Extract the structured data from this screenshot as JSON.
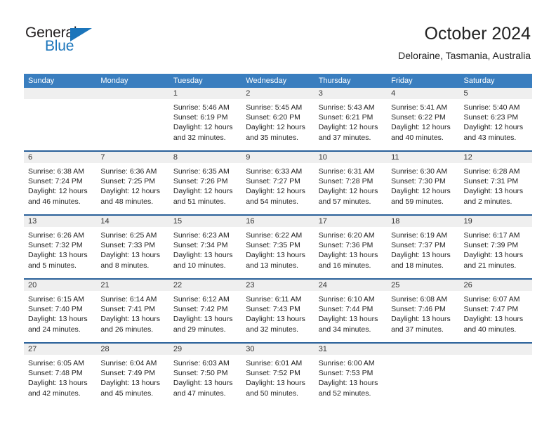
{
  "brand": {
    "name_top": "General",
    "name_bottom": "Blue",
    "accent_color": "#1b75bb",
    "text_color": "#231f20"
  },
  "header": {
    "title": "October 2024",
    "subtitle": "Deloraine, Tasmania, Australia"
  },
  "theme": {
    "header_row_bg": "#3a7ebf",
    "week_divider": "#2a6099",
    "day_number_bg": "#efefef",
    "page_bg": "#ffffff"
  },
  "weekdays": [
    "Sunday",
    "Monday",
    "Tuesday",
    "Wednesday",
    "Thursday",
    "Friday",
    "Saturday"
  ],
  "weeks": [
    [
      {
        "day": "",
        "empty": true,
        "lines": []
      },
      {
        "day": "",
        "empty": true,
        "lines": []
      },
      {
        "day": "1",
        "empty": false,
        "lines": [
          "Sunrise: 5:46 AM",
          "Sunset: 6:19 PM",
          "Daylight: 12 hours",
          "and 32 minutes."
        ]
      },
      {
        "day": "2",
        "empty": false,
        "lines": [
          "Sunrise: 5:45 AM",
          "Sunset: 6:20 PM",
          "Daylight: 12 hours",
          "and 35 minutes."
        ]
      },
      {
        "day": "3",
        "empty": false,
        "lines": [
          "Sunrise: 5:43 AM",
          "Sunset: 6:21 PM",
          "Daylight: 12 hours",
          "and 37 minutes."
        ]
      },
      {
        "day": "4",
        "empty": false,
        "lines": [
          "Sunrise: 5:41 AM",
          "Sunset: 6:22 PM",
          "Daylight: 12 hours",
          "and 40 minutes."
        ]
      },
      {
        "day": "5",
        "empty": false,
        "lines": [
          "Sunrise: 5:40 AM",
          "Sunset: 6:23 PM",
          "Daylight: 12 hours",
          "and 43 minutes."
        ]
      }
    ],
    [
      {
        "day": "6",
        "empty": false,
        "lines": [
          "Sunrise: 6:38 AM",
          "Sunset: 7:24 PM",
          "Daylight: 12 hours",
          "and 46 minutes."
        ]
      },
      {
        "day": "7",
        "empty": false,
        "lines": [
          "Sunrise: 6:36 AM",
          "Sunset: 7:25 PM",
          "Daylight: 12 hours",
          "and 48 minutes."
        ]
      },
      {
        "day": "8",
        "empty": false,
        "lines": [
          "Sunrise: 6:35 AM",
          "Sunset: 7:26 PM",
          "Daylight: 12 hours",
          "and 51 minutes."
        ]
      },
      {
        "day": "9",
        "empty": false,
        "lines": [
          "Sunrise: 6:33 AM",
          "Sunset: 7:27 PM",
          "Daylight: 12 hours",
          "and 54 minutes."
        ]
      },
      {
        "day": "10",
        "empty": false,
        "lines": [
          "Sunrise: 6:31 AM",
          "Sunset: 7:28 PM",
          "Daylight: 12 hours",
          "and 57 minutes."
        ]
      },
      {
        "day": "11",
        "empty": false,
        "lines": [
          "Sunrise: 6:30 AM",
          "Sunset: 7:30 PM",
          "Daylight: 12 hours",
          "and 59 minutes."
        ]
      },
      {
        "day": "12",
        "empty": false,
        "lines": [
          "Sunrise: 6:28 AM",
          "Sunset: 7:31 PM",
          "Daylight: 13 hours",
          "and 2 minutes."
        ]
      }
    ],
    [
      {
        "day": "13",
        "empty": false,
        "lines": [
          "Sunrise: 6:26 AM",
          "Sunset: 7:32 PM",
          "Daylight: 13 hours",
          "and 5 minutes."
        ]
      },
      {
        "day": "14",
        "empty": false,
        "lines": [
          "Sunrise: 6:25 AM",
          "Sunset: 7:33 PM",
          "Daylight: 13 hours",
          "and 8 minutes."
        ]
      },
      {
        "day": "15",
        "empty": false,
        "lines": [
          "Sunrise: 6:23 AM",
          "Sunset: 7:34 PM",
          "Daylight: 13 hours",
          "and 10 minutes."
        ]
      },
      {
        "day": "16",
        "empty": false,
        "lines": [
          "Sunrise: 6:22 AM",
          "Sunset: 7:35 PM",
          "Daylight: 13 hours",
          "and 13 minutes."
        ]
      },
      {
        "day": "17",
        "empty": false,
        "lines": [
          "Sunrise: 6:20 AM",
          "Sunset: 7:36 PM",
          "Daylight: 13 hours",
          "and 16 minutes."
        ]
      },
      {
        "day": "18",
        "empty": false,
        "lines": [
          "Sunrise: 6:19 AM",
          "Sunset: 7:37 PM",
          "Daylight: 13 hours",
          "and 18 minutes."
        ]
      },
      {
        "day": "19",
        "empty": false,
        "lines": [
          "Sunrise: 6:17 AM",
          "Sunset: 7:39 PM",
          "Daylight: 13 hours",
          "and 21 minutes."
        ]
      }
    ],
    [
      {
        "day": "20",
        "empty": false,
        "lines": [
          "Sunrise: 6:15 AM",
          "Sunset: 7:40 PM",
          "Daylight: 13 hours",
          "and 24 minutes."
        ]
      },
      {
        "day": "21",
        "empty": false,
        "lines": [
          "Sunrise: 6:14 AM",
          "Sunset: 7:41 PM",
          "Daylight: 13 hours",
          "and 26 minutes."
        ]
      },
      {
        "day": "22",
        "empty": false,
        "lines": [
          "Sunrise: 6:12 AM",
          "Sunset: 7:42 PM",
          "Daylight: 13 hours",
          "and 29 minutes."
        ]
      },
      {
        "day": "23",
        "empty": false,
        "lines": [
          "Sunrise: 6:11 AM",
          "Sunset: 7:43 PM",
          "Daylight: 13 hours",
          "and 32 minutes."
        ]
      },
      {
        "day": "24",
        "empty": false,
        "lines": [
          "Sunrise: 6:10 AM",
          "Sunset: 7:44 PM",
          "Daylight: 13 hours",
          "and 34 minutes."
        ]
      },
      {
        "day": "25",
        "empty": false,
        "lines": [
          "Sunrise: 6:08 AM",
          "Sunset: 7:46 PM",
          "Daylight: 13 hours",
          "and 37 minutes."
        ]
      },
      {
        "day": "26",
        "empty": false,
        "lines": [
          "Sunrise: 6:07 AM",
          "Sunset: 7:47 PM",
          "Daylight: 13 hours",
          "and 40 minutes."
        ]
      }
    ],
    [
      {
        "day": "27",
        "empty": false,
        "lines": [
          "Sunrise: 6:05 AM",
          "Sunset: 7:48 PM",
          "Daylight: 13 hours",
          "and 42 minutes."
        ]
      },
      {
        "day": "28",
        "empty": false,
        "lines": [
          "Sunrise: 6:04 AM",
          "Sunset: 7:49 PM",
          "Daylight: 13 hours",
          "and 45 minutes."
        ]
      },
      {
        "day": "29",
        "empty": false,
        "lines": [
          "Sunrise: 6:03 AM",
          "Sunset: 7:50 PM",
          "Daylight: 13 hours",
          "and 47 minutes."
        ]
      },
      {
        "day": "30",
        "empty": false,
        "lines": [
          "Sunrise: 6:01 AM",
          "Sunset: 7:52 PM",
          "Daylight: 13 hours",
          "and 50 minutes."
        ]
      },
      {
        "day": "31",
        "empty": false,
        "lines": [
          "Sunrise: 6:00 AM",
          "Sunset: 7:53 PM",
          "Daylight: 13 hours",
          "and 52 minutes."
        ]
      },
      {
        "day": "",
        "empty": true,
        "lines": []
      },
      {
        "day": "",
        "empty": true,
        "lines": []
      }
    ]
  ]
}
